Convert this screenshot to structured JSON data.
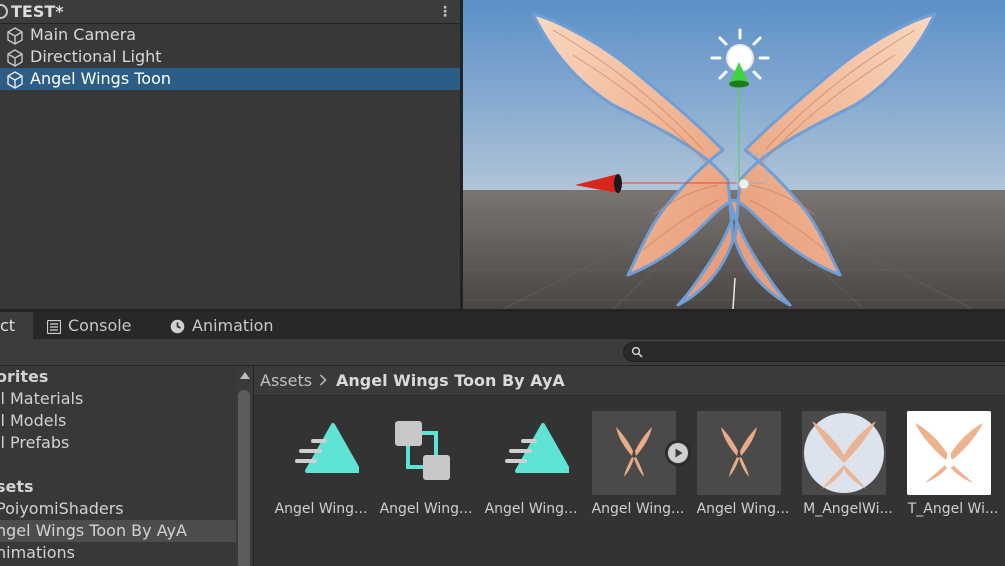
{
  "hierarchy": {
    "scene_title": "TEST*",
    "items": [
      {
        "label": "Main Camera",
        "selected": false
      },
      {
        "label": "Directional Light",
        "selected": false
      },
      {
        "label": "Angel Wings Toon",
        "selected": true
      }
    ]
  },
  "bottom_tabs": [
    {
      "label": "ct",
      "icon": "folder-icon",
      "active": true
    },
    {
      "label": "Console",
      "icon": "console-icon",
      "active": false
    },
    {
      "label": "Animation",
      "icon": "animation-clock-icon",
      "active": false
    }
  ],
  "search": {
    "placeholder": ""
  },
  "folder_tree": {
    "favorites_header": "orites",
    "favorites": [
      "ll Materials",
      "ll Models",
      "ll Prefabs"
    ],
    "assets_header": "sets",
    "assets": [
      "PoiyomiShaders",
      "ngel Wings Toon By AyA",
      "nimations"
    ],
    "selected": "ngel Wings Toon By AyA"
  },
  "breadcrumb": {
    "root": "Assets",
    "current": "Angel Wings Toon By AyA"
  },
  "assets": [
    {
      "label": "Angel Wing...",
      "icon": "animation-clip-icon"
    },
    {
      "label": "Angel Wing...",
      "icon": "animator-controller-icon"
    },
    {
      "label": "Angel Wing...",
      "icon": "animation-clip-icon"
    },
    {
      "label": "Angel Wing...",
      "icon": "wings-model-icon"
    },
    {
      "label": "Angel Wing...",
      "icon": "wings-mesh-icon"
    },
    {
      "label": "M_AngelWi...",
      "icon": "material-sphere-icon"
    },
    {
      "label": "T_Angel Wi...",
      "icon": "texture-icon"
    }
  ],
  "colors": {
    "selection": "#2c5d87",
    "accent_teal": "#5fe3d5",
    "panel": "#383838"
  }
}
